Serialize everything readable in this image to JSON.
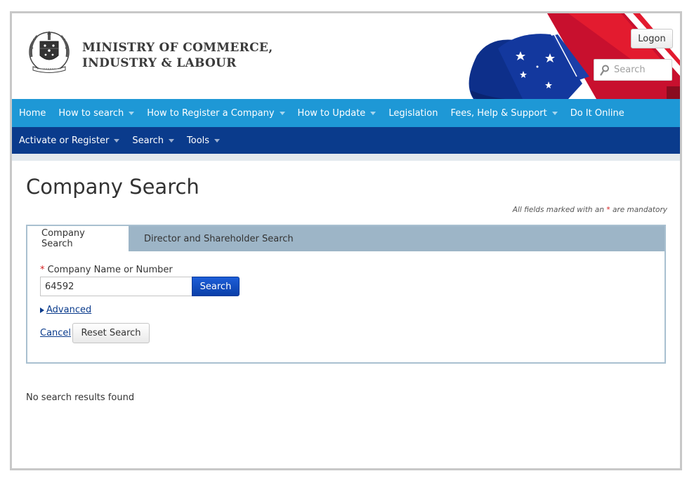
{
  "header": {
    "ministry_line1": "MINISTRY OF COMMERCE,",
    "ministry_line2": "INDUSTRY & LABOUR",
    "logon_label": "Logon",
    "search_placeholder": "Search"
  },
  "nav_primary": [
    {
      "label": "Home",
      "has_dropdown": false
    },
    {
      "label": "How to search",
      "has_dropdown": true
    },
    {
      "label": "How to Register a Company",
      "has_dropdown": true
    },
    {
      "label": "How to Update",
      "has_dropdown": true
    },
    {
      "label": "Legislation",
      "has_dropdown": false
    },
    {
      "label": "Fees, Help & Support",
      "has_dropdown": true
    },
    {
      "label": "Do It Online",
      "has_dropdown": false
    }
  ],
  "nav_secondary": [
    {
      "label": "Activate or Register",
      "has_dropdown": true
    },
    {
      "label": "Search",
      "has_dropdown": true
    },
    {
      "label": "Tools",
      "has_dropdown": true
    }
  ],
  "page": {
    "title": "Company Search",
    "mandatory_note_before": "All fields marked with an",
    "mandatory_marker": "*",
    "mandatory_note_after": "are mandatory"
  },
  "tabs": [
    {
      "label": "Company Search",
      "active": true
    },
    {
      "label": "Director and Shareholder Search",
      "active": false
    }
  ],
  "form": {
    "required_marker": "*",
    "field_label": "Company Name or Number",
    "field_value": "64592",
    "search_button": "Search",
    "advanced_link": "Advanced",
    "cancel_link": "Cancel",
    "reset_button": "Reset Search"
  },
  "results": {
    "message": "No search results found"
  },
  "colors": {
    "nav_primary_bg": "#1e98d6",
    "nav_secondary_bg": "#0a3b8c",
    "search_button_bg": "#1d5ed8",
    "tab_strip_bg": "#9db5c7",
    "required_color": "#d42020"
  }
}
